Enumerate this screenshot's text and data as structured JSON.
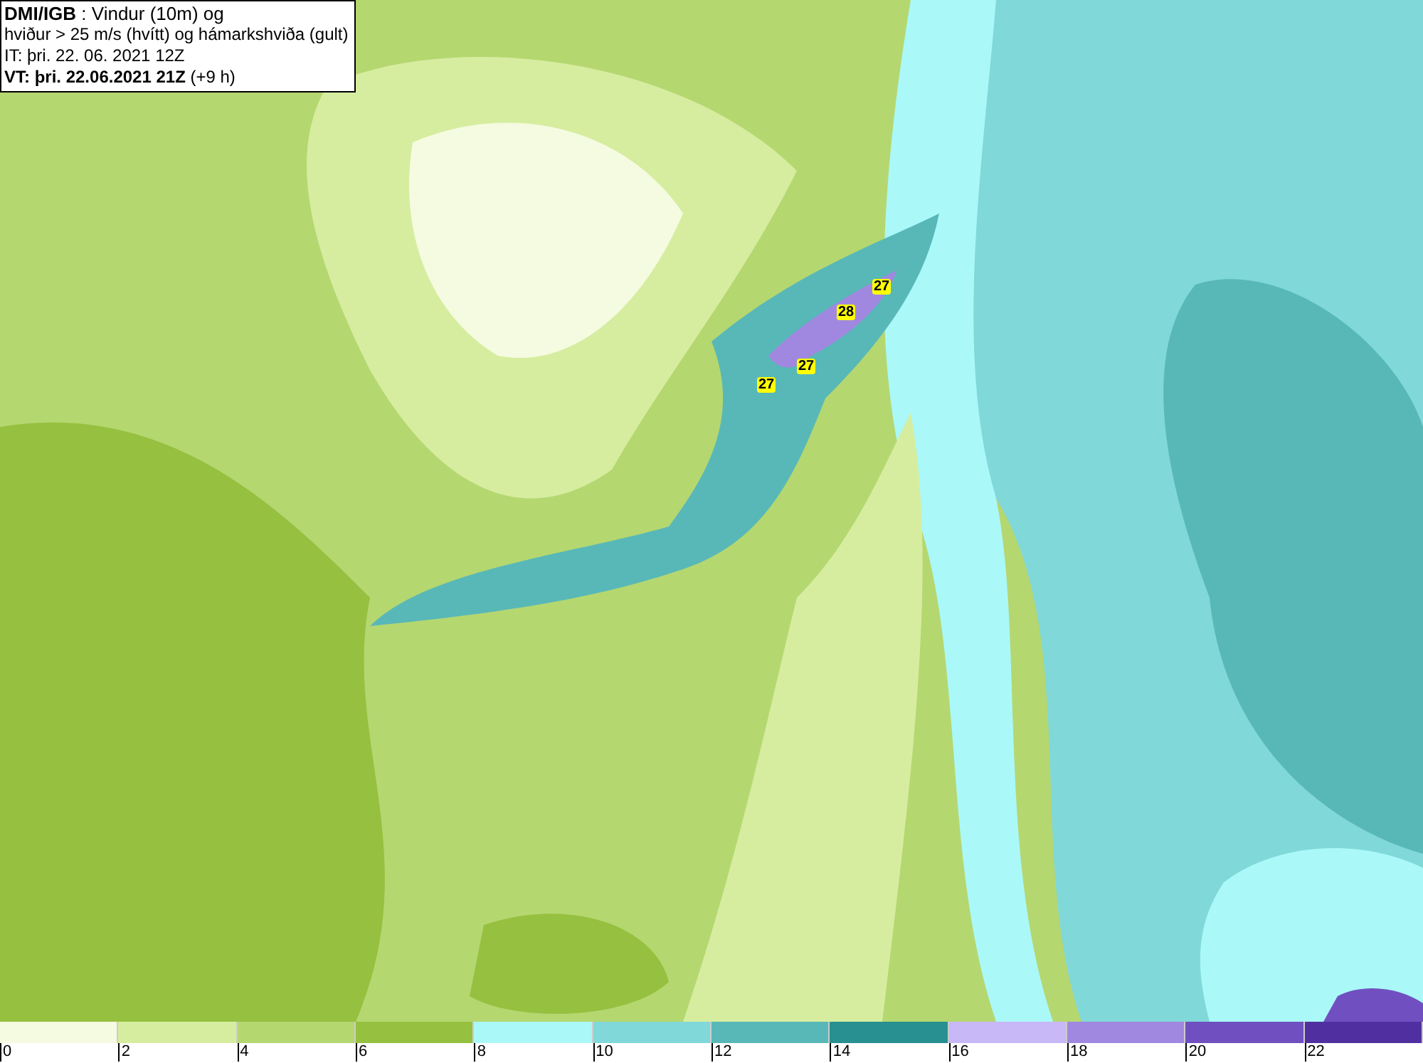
{
  "title_box": {
    "lines": [
      "**DMI/IGB** : Vindur (10m) og",
      "hviður > 25 m/s (hvítt) og hámarkshviða (gult)",
      "IT: þri. 22. 06. 2021 12Z",
      "**VT: þri. 22.06.2021 21Z** (+9 h)"
    ]
  },
  "gust_markers": [
    {
      "value": "27"
    },
    {
      "value": "28"
    },
    {
      "value": "27"
    },
    {
      "value": "27"
    }
  ],
  "legend": [
    {
      "label": "0",
      "color": "#f5fbe0"
    },
    {
      "label": "2",
      "color": "#d6eda0"
    },
    {
      "label": "4",
      "color": "#b5d770"
    },
    {
      "label": "6",
      "color": "#96c040"
    },
    {
      "label": "8",
      "color": "#aaf8f8"
    },
    {
      "label": "10",
      "color": "#80d8d8"
    },
    {
      "label": "12",
      "color": "#58b8b8"
    },
    {
      "label": "14",
      "color": "#289090"
    },
    {
      "label": "16",
      "color": "#c8b8f8"
    },
    {
      "label": "18",
      "color": "#a088e0"
    },
    {
      "label": "20",
      "color": "#7050c0"
    },
    {
      "label": "22",
      "color": "#5030a0"
    }
  ]
}
